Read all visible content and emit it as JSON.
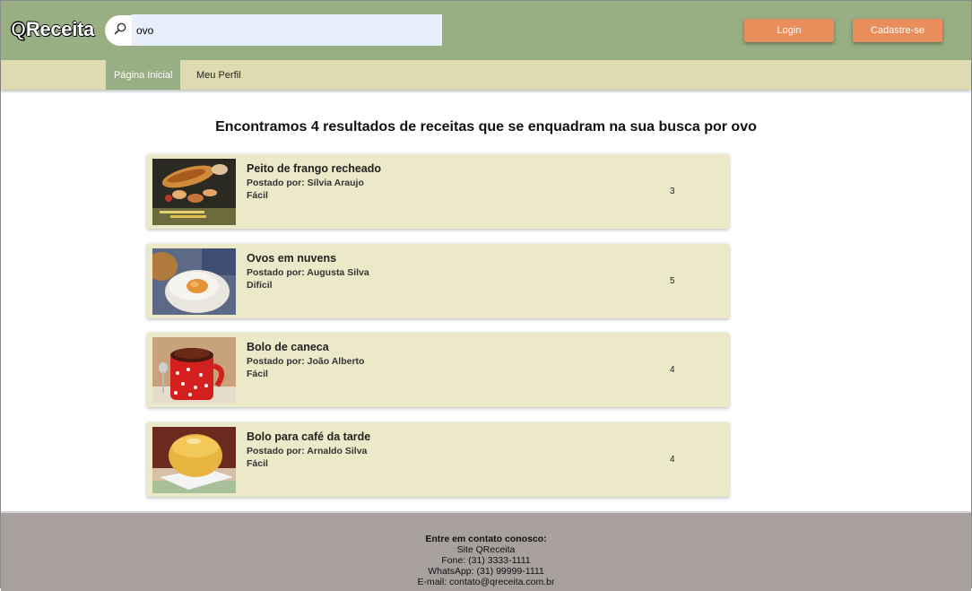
{
  "header": {
    "logo_q": "Q",
    "logo_rest": "Receita",
    "search": {
      "value": "ovo",
      "icon": "search-icon"
    },
    "login_label": "Login",
    "signup_label": "Cadastre-se",
    "colors": {
      "bar": "#98ae83",
      "button": "#e98d5a"
    }
  },
  "nav": {
    "items": [
      {
        "label": "Página Inicial",
        "active": true
      },
      {
        "label": "Meu Perfil",
        "active": false
      }
    ]
  },
  "results": {
    "title": "Encontramos 4 resultados de receitas que se enquadram na sua busca por ovo",
    "items": [
      {
        "title": "Peito de frango recheado",
        "author": "Postado por: Sílvia Araujo",
        "level": "Fácil",
        "count": "3"
      },
      {
        "title": "Ovos em nuvens",
        "author": "Postado por: Augusta Silva",
        "level": "Difícil",
        "count": "5"
      },
      {
        "title": "Bolo de caneca",
        "author": "Postado por: João Alberto",
        "level": "Fácil",
        "count": "4"
      },
      {
        "title": "Bolo para café da tarde",
        "author": "Postado por: Arnaldo Silva",
        "level": "Fácil",
        "count": "4"
      }
    ]
  },
  "footer": {
    "heading": "Entre em contato conosco:",
    "site": "Site QReceita",
    "phone": "Fone: (31) 3333-1111",
    "whatsapp": "WhatsApp: (31) 99999-1111",
    "email": "E-mail: contato@qreceita.com.br"
  }
}
